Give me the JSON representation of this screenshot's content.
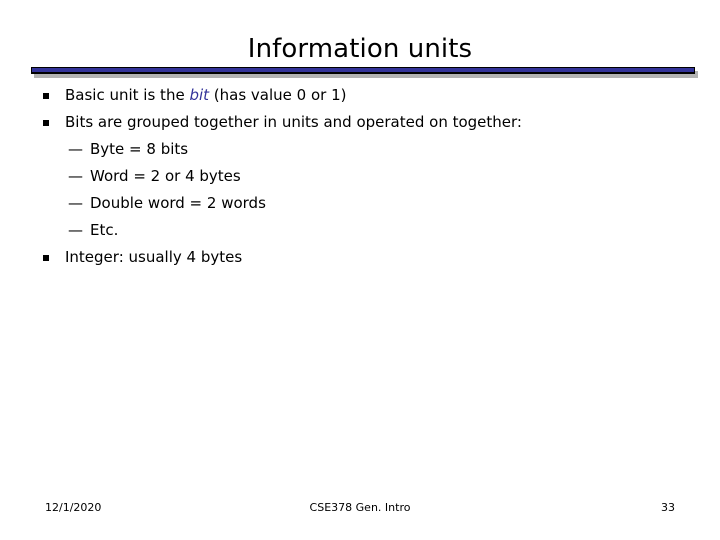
{
  "slide": {
    "title": "Information units",
    "accent_color": "#333399",
    "rule_outline_color": "#000000",
    "rule_shadow_color": "#b3b3b3",
    "background_color": "#ffffff",
    "text_color": "#000000"
  },
  "body": {
    "bullets": [
      {
        "level": 1,
        "marker": "square-bullet",
        "text_before": "Basic unit is the ",
        "emphasis": "bit",
        "text_after": " (has value 0 or 1)",
        "full_text": "Basic unit is the bit (has value 0 or 1)"
      },
      {
        "level": 1,
        "marker": "square-bullet",
        "text": "Bits are grouped together in units and operated on together:"
      },
      {
        "level": 2,
        "marker": "em-dash",
        "text": "Byte = 8 bits"
      },
      {
        "level": 2,
        "marker": "em-dash",
        "text": "Word = 2 or 4 bytes"
      },
      {
        "level": 2,
        "marker": "em-dash",
        "text": "Double word = 2 words"
      },
      {
        "level": 2,
        "marker": "em-dash",
        "text": "Etc."
      },
      {
        "level": 1,
        "marker": "square-bullet",
        "text": "Integer: usually 4 bytes"
      }
    ],
    "dash_glyph": "—"
  },
  "footer": {
    "date": "12/1/2020",
    "center": "CSE378 Gen. Intro",
    "page_number": "33"
  }
}
